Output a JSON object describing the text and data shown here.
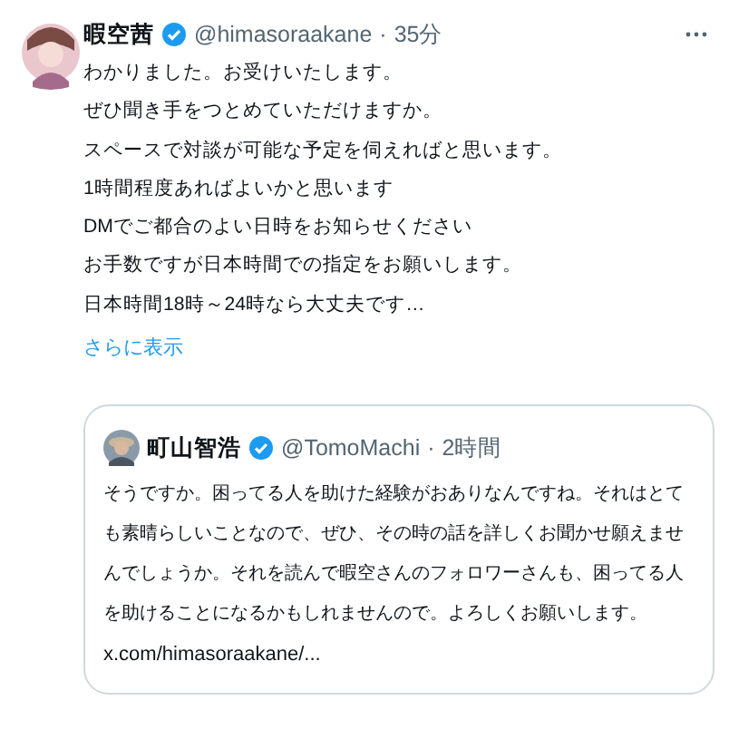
{
  "tweet": {
    "name": "暇空茜",
    "handle": "@himasoraakane",
    "separator": "·",
    "time": "35分",
    "verified": true,
    "lines": [
      "わかりました。お受けいたします。",
      "ぜひ聞き手をつとめていただけますか。",
      "スペースで対談が可能な予定を伺えればと思います。",
      "1時間程度あればよいかと思います",
      "DMでご都合のよい日時をお知らせください",
      "お手数ですが日本時間での指定をお願いします。",
      "日本時間18時～24時なら大丈夫です…"
    ],
    "show_more": "さらに表示",
    "quote": {
      "name": "町山智浩",
      "handle": "@TomoMachi",
      "separator": "·",
      "time": "2時間",
      "verified": true,
      "text": "そうですか。困ってる人を助けた経験がおありなんですね。それはとても素晴らしいことなので、ぜひ、その時の話を詳しくお聞かせ願えませんでしょうか。それを読んで暇空さんのフォロワーさんも、困ってる人を助けることになるかもしれませんので。よろしくお願いします。",
      "link": "x.com/himasoraakane/..."
    }
  }
}
